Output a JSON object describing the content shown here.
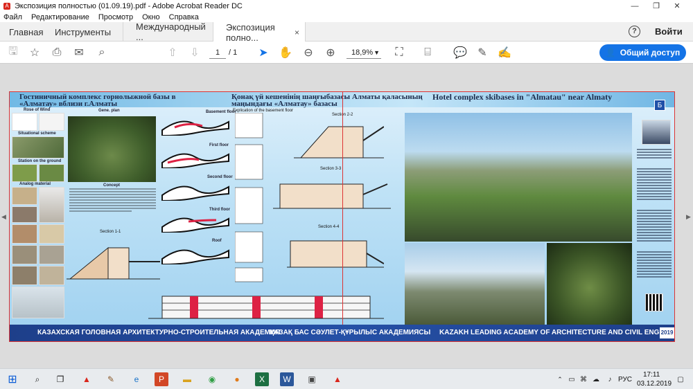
{
  "window": {
    "title": "Экспозиция полностью  (01.09.19).pdf - Adobe Acrobat Reader DC",
    "minimize": "—",
    "maximize": "❐",
    "close": "✕"
  },
  "menu": [
    "Файл",
    "Редактирование",
    "Просмотр",
    "Окно",
    "Справка"
  ],
  "tabs": {
    "home": "Главная",
    "tools": "Инструменты",
    "doc1": "Международный ...",
    "doc2": "Экспозиция полно...",
    "close": "×"
  },
  "header_right": {
    "help": "?",
    "signin": "Войти"
  },
  "toolbar": {
    "page_current": "1",
    "page_total": "/ 1",
    "zoom": "18,9%",
    "share_label": "Общий доступ"
  },
  "poster": {
    "title_ru": "Гостиничный комплекс горнолыжной базы в «Алматау» вблизи г.Алматы",
    "title_kz": "Қонақ үй кешенінің шаңғыбазасы Алматы қаласының маңындағы «Алматау» базасы",
    "title_en": "Hotel complex skibases in \"Almatau\" near Almaty",
    "badge": "Б",
    "labels": {
      "gen_plan": "Gene. plan",
      "rose": "Rose of Wind",
      "situational": "Situational scheme",
      "station": "Station on the ground",
      "analog": "Analog material",
      "concept": "Concept",
      "section11": "Section 1-1",
      "basement": "Basement floor",
      "first": "First floor",
      "second": "Second floor",
      "third": "Third floor",
      "roof": "Roof",
      "section22": "Section 2-2",
      "section33": "Section 3-3",
      "section44": "Section 4-4",
      "explication": "Explication of the basement floor"
    },
    "footer": {
      "ru": "КАЗАХСКАЯ ГОЛОВНАЯ АРХИТЕКТУРНО-СТРОИТЕЛЬНАЯ АКАДЕМИЯ",
      "kz": "ҚАЗАҚ БАС СӘУЛЕТ-ҚҰРЫЛЫС АКАДЕМИЯСЫ",
      "en": "KAZAKH LEADING ACADEMY OF ARCHITECTURE AND CIVIL ENGINEERING",
      "year": "2019"
    }
  },
  "taskbar": {
    "lang": "РУС",
    "time": "17:11",
    "date": "03.12.2019"
  },
  "colors": {
    "accent": "#1473e6",
    "footer": "#1e3f8a",
    "pdf_red": "#d9261c"
  }
}
